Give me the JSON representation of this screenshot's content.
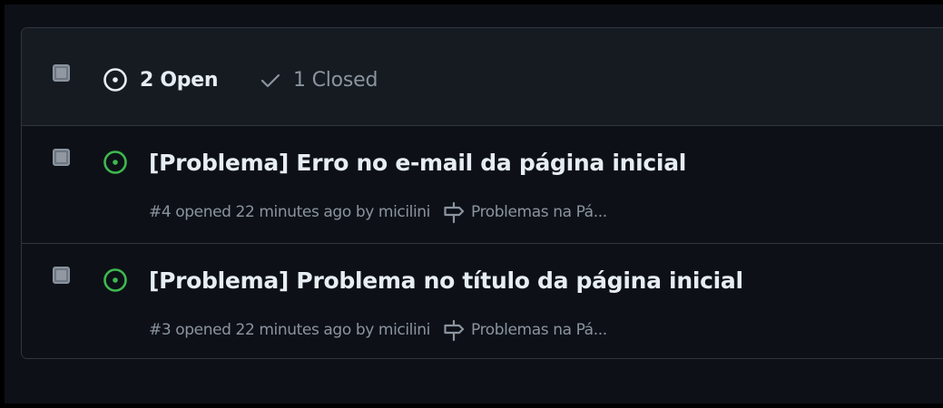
{
  "header": {
    "open_count_label": "2 Open",
    "closed_count_label": "1 Closed"
  },
  "issues": [
    {
      "title": "[Problema] Erro no e-mail da página inicial",
      "number": "#4",
      "opened_text": "opened 22 minutes ago by",
      "author": "micilini",
      "milestone": "Problemas na Pá..."
    },
    {
      "title": "[Problema] Problema no título da página inicial",
      "number": "#3",
      "opened_text": "opened 22 minutes ago by",
      "author": "micilini",
      "milestone": "Problemas na Pá..."
    }
  ],
  "colors": {
    "open_green": "#3fb950",
    "text_primary": "#e6edf3",
    "text_muted": "#8b949e",
    "border": "#30363d",
    "header_bg": "#161b22",
    "page_bg": "#0d1117"
  },
  "icons": {
    "open_tab": "issue-opened-icon",
    "closed_tab": "check-icon",
    "issue_state": "issue-opened-icon",
    "milestone": "milestone-icon"
  }
}
